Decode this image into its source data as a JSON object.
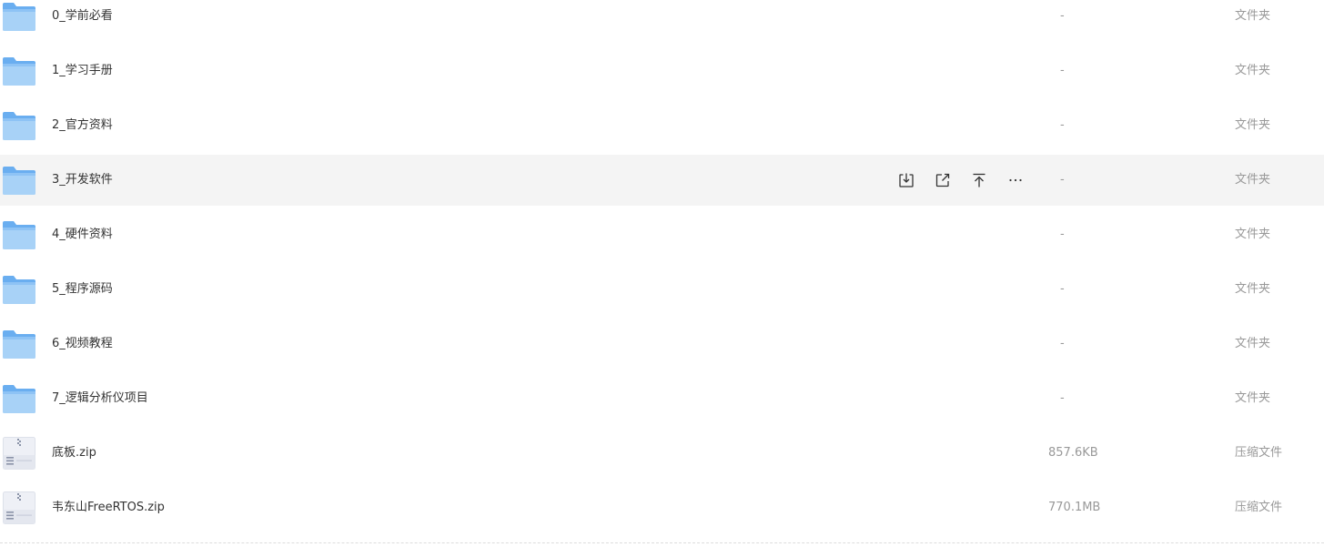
{
  "files": [
    {
      "name": "0_学前必看",
      "size": "-",
      "type": "文件夹",
      "icon": "folder-icon"
    },
    {
      "name": "1_学习手册",
      "size": "-",
      "type": "文件夹",
      "icon": "folder-icon"
    },
    {
      "name": "2_官方资料",
      "size": "-",
      "type": "文件夹",
      "icon": "folder-icon"
    },
    {
      "name": "3_开发软件",
      "size": "-",
      "type": "文件夹",
      "icon": "folder-icon",
      "hovered": true
    },
    {
      "name": "4_硬件资料",
      "size": "-",
      "type": "文件夹",
      "icon": "folder-icon"
    },
    {
      "name": "5_程序源码",
      "size": "-",
      "type": "文件夹",
      "icon": "folder-icon"
    },
    {
      "name": "6_视频教程",
      "size": "-",
      "type": "文件夹",
      "icon": "folder-icon"
    },
    {
      "name": "7_逻辑分析仪项目",
      "size": "-",
      "type": "文件夹",
      "icon": "folder-icon"
    },
    {
      "name": "底板.zip",
      "size": "857.6KB",
      "type": "压缩文件",
      "icon": "zip-file-icon"
    },
    {
      "name": "韦东山FreeRTOS.zip",
      "size": "770.1MB",
      "type": "压缩文件",
      "icon": "zip-file-icon"
    }
  ],
  "row_actions": [
    {
      "name": "download",
      "icon": "download-icon"
    },
    {
      "name": "share",
      "icon": "share-icon"
    },
    {
      "name": "pin-top",
      "icon": "pin-top-icon"
    },
    {
      "name": "more",
      "icon": "more-icon"
    }
  ],
  "colors": {
    "folder_light": "#a8d2f7",
    "folder_dark": "#6aaef0",
    "hover_background": "#f4f4f4",
    "name_text": "#333333",
    "meta_text": "#999999"
  }
}
